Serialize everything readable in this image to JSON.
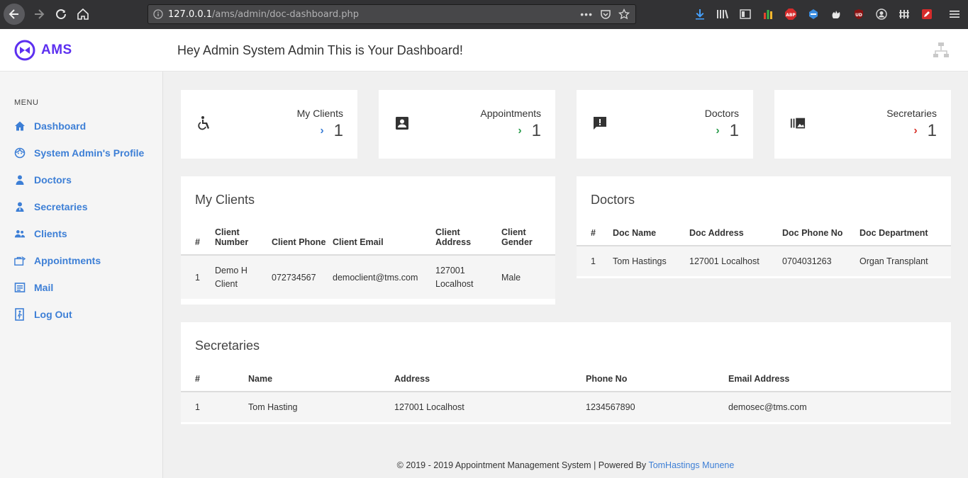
{
  "browser": {
    "url_host": "127.0.0.1",
    "url_path": "/ams/admin/doc-dashboard.php"
  },
  "app": {
    "logo_text": "AMS",
    "welcome": "Hey Admin System Admin This is Your Dashboard!"
  },
  "sidebar": {
    "menu_label": "MENU",
    "items": [
      {
        "label": "Dashboard",
        "icon": "home-icon"
      },
      {
        "label": "System Admin's Profile",
        "icon": "face-icon"
      },
      {
        "label": "Doctors",
        "icon": "doctor-icon"
      },
      {
        "label": "Secretaries",
        "icon": "person-tie-icon"
      },
      {
        "label": "Clients",
        "icon": "people-icon"
      },
      {
        "label": "Appointments",
        "icon": "briefcase-icon"
      },
      {
        "label": "Mail",
        "icon": "mail-icon"
      },
      {
        "label": "Log Out",
        "icon": "logout-icon"
      }
    ]
  },
  "stats": [
    {
      "title": "My Clients",
      "value": "1",
      "chevron_color": "#3d7fd6",
      "icon": "accessible-icon"
    },
    {
      "title": "Appointments",
      "value": "1",
      "chevron_color": "#2e9e4f",
      "icon": "contact-card-icon"
    },
    {
      "title": "Doctors",
      "value": "1",
      "chevron_color": "#2e9e4f",
      "icon": "alert-message-icon"
    },
    {
      "title": "Secretaries",
      "value": "1",
      "chevron_color": "#d9342b",
      "icon": "photo-library-icon"
    }
  ],
  "clients": {
    "title": "My Clients",
    "headers": [
      "#",
      "Client Number",
      "Client Phone",
      "Client Email",
      "Client Address",
      "Client Gender"
    ],
    "rows": [
      [
        "1",
        "Demo H Client",
        "072734567",
        "democlient@tms.com",
        "127001 Localhost",
        "Male"
      ]
    ]
  },
  "doctors": {
    "title": "Doctors",
    "headers": [
      "#",
      "Doc Name",
      "Doc Address",
      "Doc Phone No",
      "Doc Department"
    ],
    "rows": [
      [
        "1",
        "Tom Hastings",
        "127001 Localhost",
        "0704031263",
        "Organ Transplant"
      ]
    ]
  },
  "secretaries": {
    "title": "Secretaries",
    "headers": [
      "#",
      "Name",
      "Address",
      "Phone No",
      "Email Address"
    ],
    "rows": [
      [
        "1",
        "Tom Hasting",
        "127001 Localhost",
        "1234567890",
        "demosec@tms.com"
      ]
    ]
  },
  "footer": {
    "text": "© 2019 - 2019 Appointment Management System | Powered By",
    "link": "TomHastings Munene"
  },
  "colors": {
    "accent": "#3d7fd6",
    "brand": "#5c2ff0"
  }
}
